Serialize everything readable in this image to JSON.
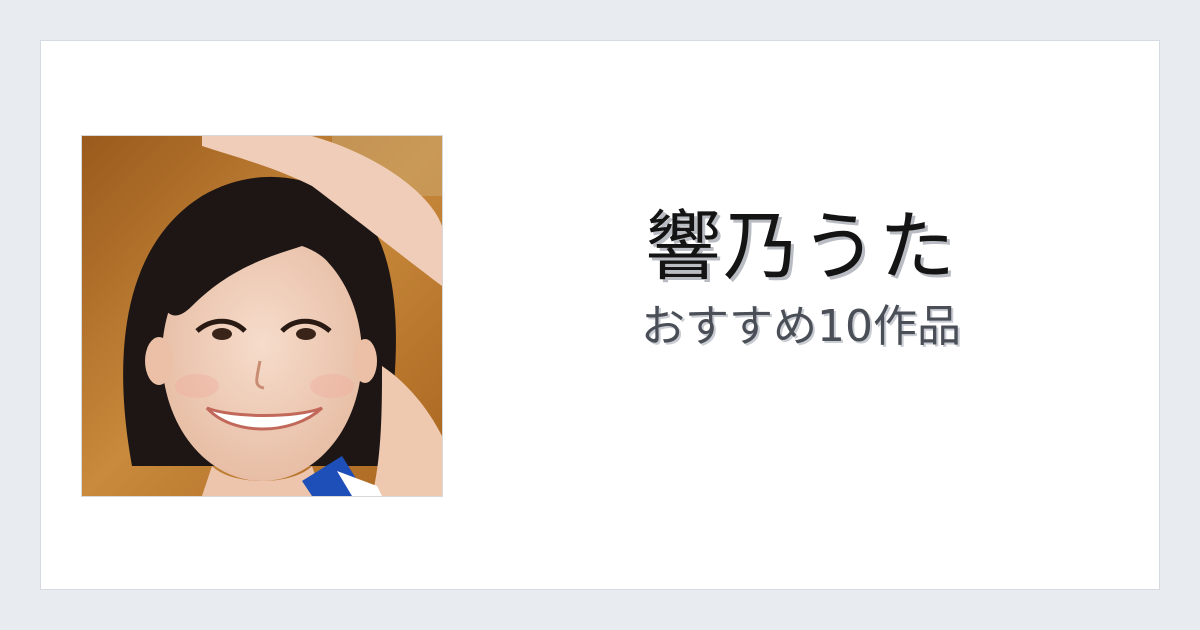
{
  "title": "響乃うた",
  "subtitle": "おすすめ10作品",
  "colors": {
    "page_background": "#e8ecf1",
    "card_background": "#ffffff",
    "title_text": "#141414",
    "subtitle_text": "#4a4e57"
  },
  "photo": {
    "icon": "portrait-photo"
  }
}
